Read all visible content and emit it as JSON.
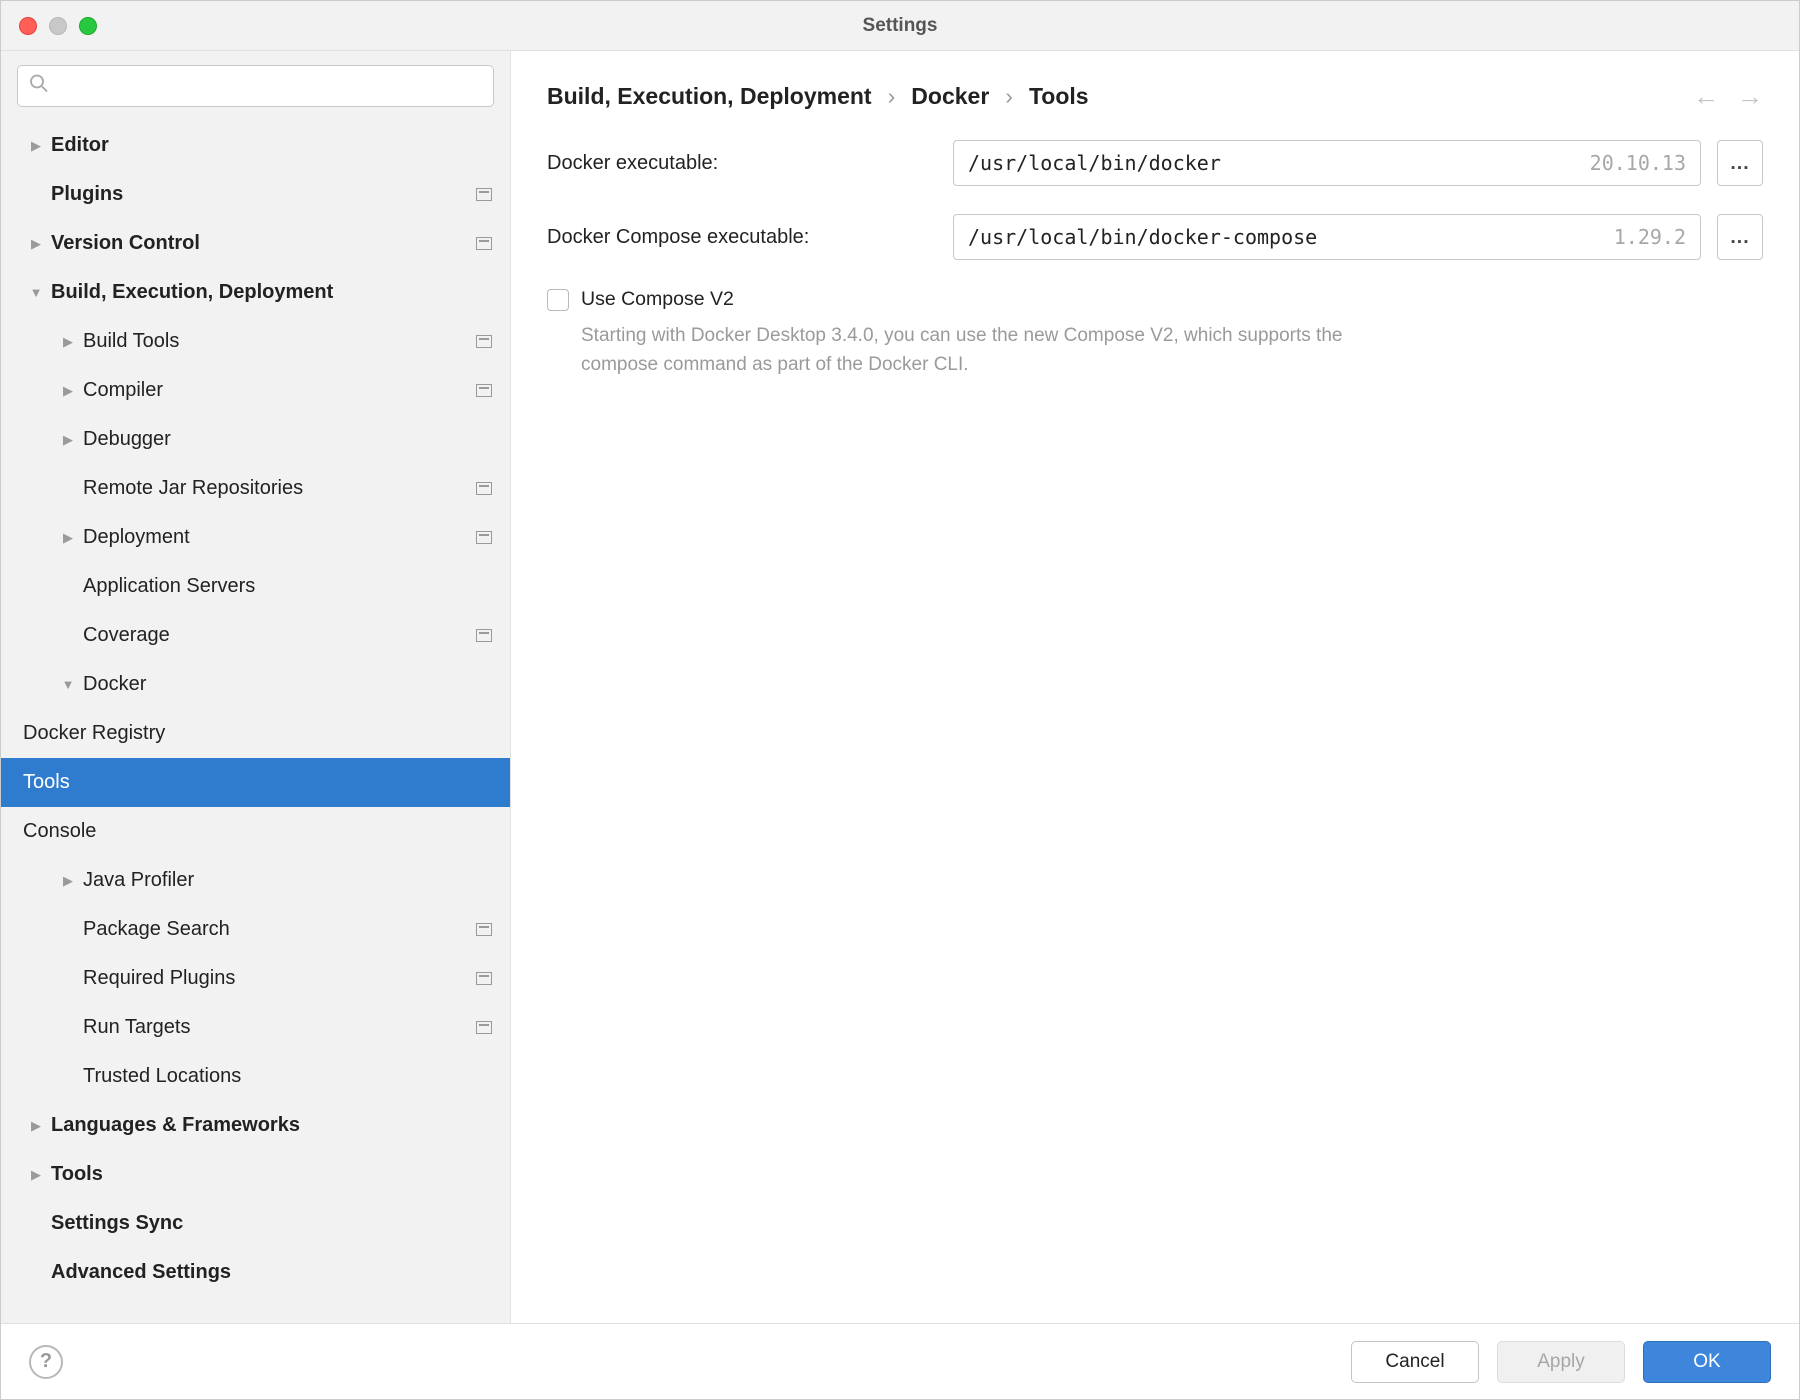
{
  "title": "Settings",
  "search": {
    "placeholder": ""
  },
  "sidebar": {
    "editor": "Editor",
    "plugins": "Plugins",
    "version_control": "Version Control",
    "bed": "Build, Execution, Deployment",
    "build_tools": "Build Tools",
    "compiler": "Compiler",
    "debugger": "Debugger",
    "remote_jar": "Remote Jar Repositories",
    "deployment": "Deployment",
    "app_servers": "Application Servers",
    "coverage": "Coverage",
    "docker": "Docker",
    "docker_registry": "Docker Registry",
    "tools": "Tools",
    "console": "Console",
    "java_profiler": "Java Profiler",
    "package_search": "Package Search",
    "required_plugins": "Required Plugins",
    "run_targets": "Run Targets",
    "trusted_locations": "Trusted Locations",
    "languages": "Languages & Frameworks",
    "tools_top": "Tools",
    "settings_sync": "Settings Sync",
    "advanced_settings": "Advanced Settings"
  },
  "breadcrumb": {
    "a": "Build, Execution, Deployment",
    "b": "Docker",
    "c": "Tools",
    "sep": "›"
  },
  "form": {
    "docker_exec_label": "Docker executable:",
    "docker_exec_value": "/usr/local/bin/docker",
    "docker_exec_version": "20.10.13",
    "compose_exec_label": "Docker Compose executable:",
    "compose_exec_value": "/usr/local/bin/docker-compose",
    "compose_exec_version": "1.29.2",
    "browse": "...",
    "use_compose_v2": "Use Compose V2",
    "compose_hint": "Starting with Docker Desktop 3.4.0, you can use the new Compose V2, which supports the compose command as part of the Docker CLI."
  },
  "footer": {
    "cancel": "Cancel",
    "apply": "Apply",
    "ok": "OK",
    "help": "?"
  }
}
